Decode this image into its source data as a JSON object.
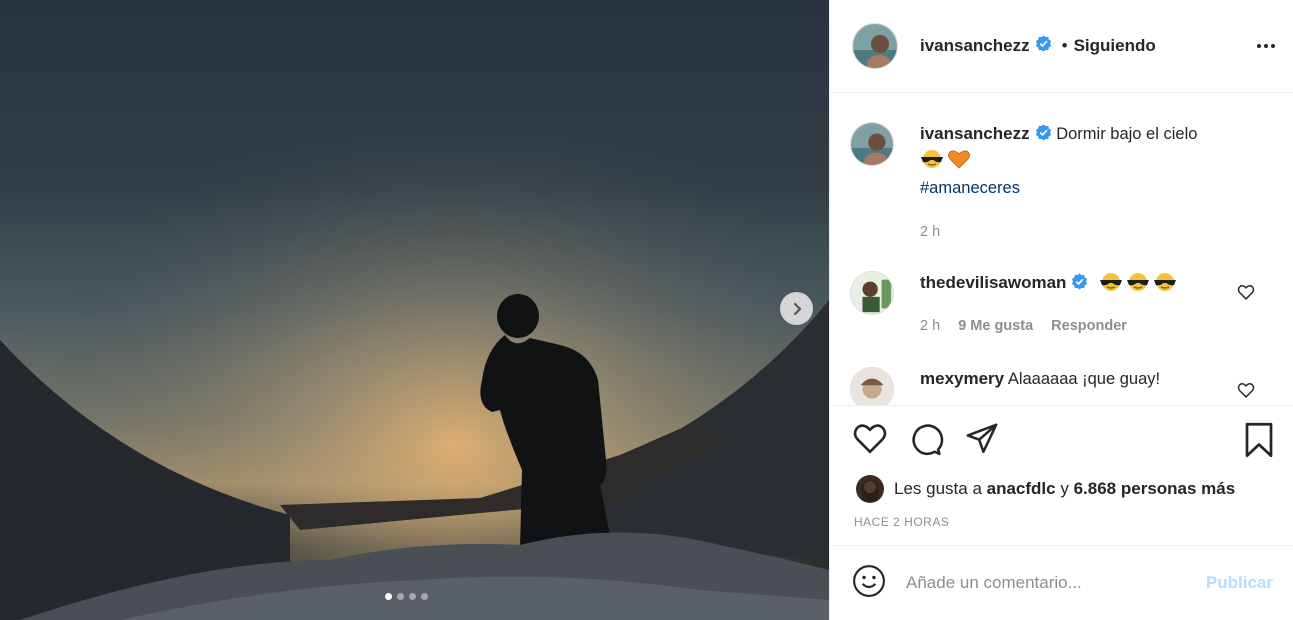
{
  "post": {
    "author": "ivansanchezz",
    "verified": true,
    "separator": "•",
    "follow_status": "Siguiendo",
    "caption": {
      "text": "Dormir bajo el cielo",
      "emojis": [
        "sunglasses-face-emoji",
        "orange-heart-emoji"
      ],
      "hashtag": "#amaneceres",
      "time": "2 h"
    },
    "media": {
      "slide_count": 4,
      "active_slide": 1
    }
  },
  "comments": [
    {
      "user": "thedevilisawoman",
      "verified": true,
      "text_emojis": [
        "sunglasses-face-emoji",
        "sunglasses-face-emoji",
        "sunglasses-face-emoji"
      ],
      "time": "2 h",
      "likes": "9 Me gusta",
      "reply": "Responder"
    },
    {
      "user": "mexymery",
      "verified": false,
      "text": "Alaaaaaa ¡que guay!"
    }
  ],
  "likes": {
    "prefix": "Les gusta a",
    "user": "anacfdlc",
    "conjunction": "y",
    "others": "6.868 personas más"
  },
  "timestamp": "HACE 2 HORAS",
  "comment_box": {
    "placeholder": "Añade un comentario...",
    "publish": "Publicar"
  },
  "colors": {
    "verified": "#3897f0",
    "link": "#00376b",
    "muted": "#8e8e8e",
    "publish_disabled": "#b2dffc"
  }
}
